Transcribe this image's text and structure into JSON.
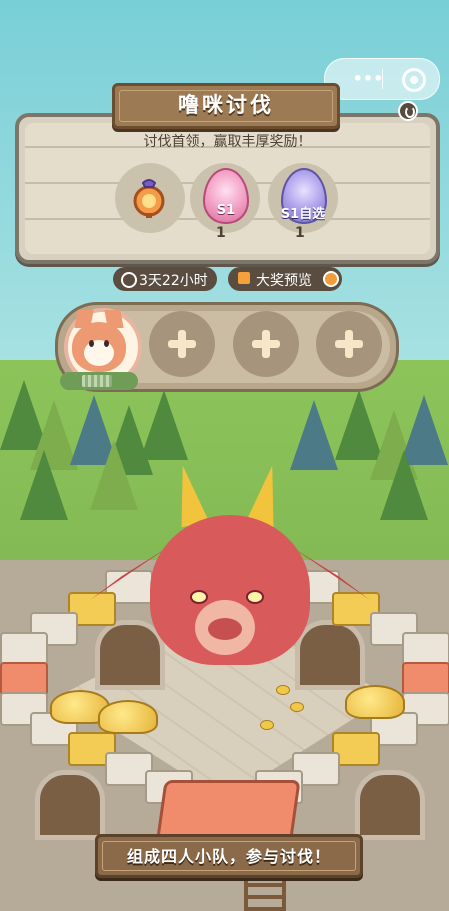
{
  "header": {
    "title": "噜咪讨伐",
    "subtitle": "讨伐首领，赢取丰厚奖励！"
  },
  "rewards": [
    {
      "icon": "amulet-icon",
      "label": "",
      "count": ""
    },
    {
      "icon": "pink-egg-icon",
      "label": "S1",
      "count": "1"
    },
    {
      "icon": "purple-mystery-egg-icon",
      "label": "S1自选",
      "count": "1"
    }
  ],
  "timer": {
    "text": "3天22小时"
  },
  "preview": {
    "text": "大奖预览"
  },
  "team": {
    "slots": [
      "member",
      "add",
      "add",
      "add"
    ]
  },
  "banner": {
    "text": "组成四人小队，参与讨伐！"
  },
  "capsule": {
    "dots": "•••"
  }
}
